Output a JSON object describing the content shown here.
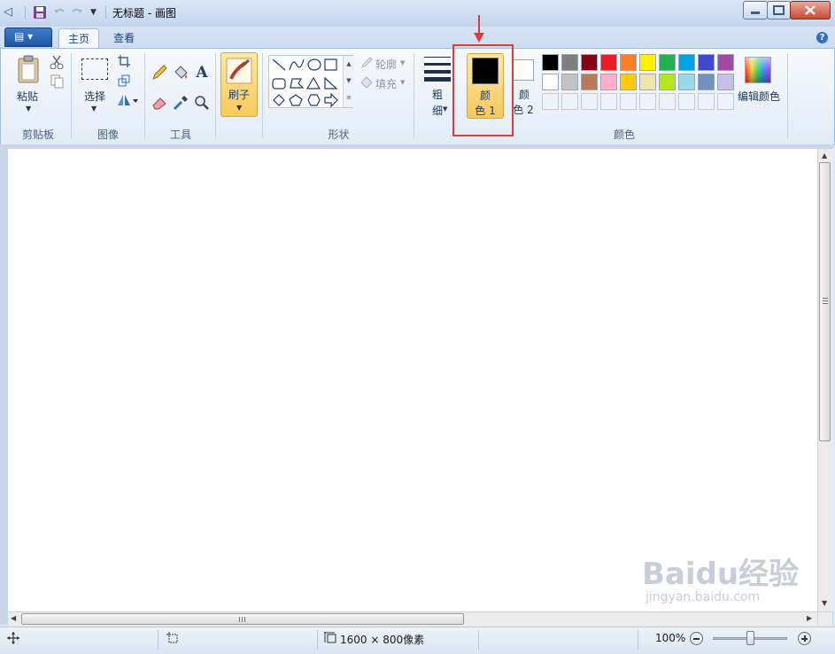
{
  "window": {
    "title": "无标题 - 画图"
  },
  "ribbon_tabs": {
    "file_menu": "▤ ▾",
    "home": "主页",
    "view": "查看"
  },
  "help_label": "?",
  "groups": {
    "clipboard": {
      "label": "剪贴板",
      "paste": "粘贴"
    },
    "image": {
      "label": "图像",
      "select": "选择"
    },
    "tools": {
      "label": "工具",
      "text_tool": "A"
    },
    "brushes": {
      "label": "刷子"
    },
    "shapes": {
      "label": "形状",
      "outline": "轮廓",
      "fill": "填充"
    },
    "size": {
      "label_top": "粗",
      "label_bottom": "细"
    },
    "colors": {
      "label": "颜色",
      "color1_top": "颜",
      "color1_bottom": "色 1",
      "color2_top": "颜",
      "color2_bottom": "色 2",
      "edit_colors": "编辑颜色",
      "color1_value": "#000000",
      "color2_value": "#ffffff",
      "palette_row1": [
        "#000000",
        "#7f7f7f",
        "#880015",
        "#ed1c24",
        "#ff7f27",
        "#fff200",
        "#22b14c",
        "#00a2e8",
        "#3f48cc",
        "#a349a4"
      ],
      "palette_row2": [
        "#ffffff",
        "#c3c3c3",
        "#b97a57",
        "#ffaec9",
        "#ffc90e",
        "#efe4b0",
        "#b5e61d",
        "#99d9ea",
        "#7092be",
        "#c8bfe7"
      ]
    }
  },
  "statusbar": {
    "canvas_size": "1600 × 800像素",
    "zoom": "100%",
    "zoom_level": 0.5
  },
  "watermark": {
    "brand": "Baidu经验",
    "url": "jingyan.baidu.com"
  }
}
